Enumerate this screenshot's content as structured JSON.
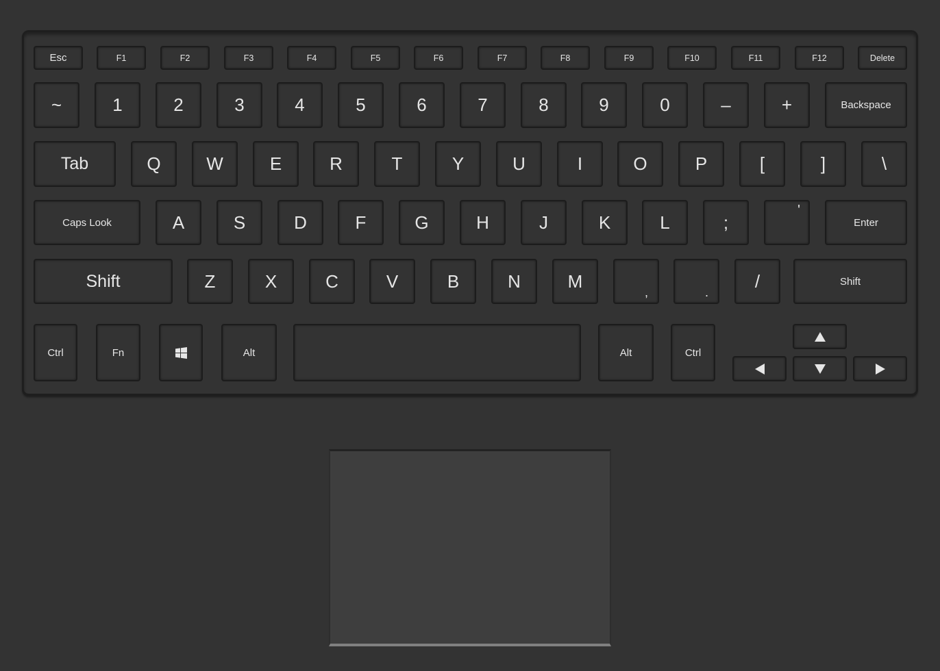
{
  "keyboard": {
    "function_row": [
      "Esc",
      "F1",
      "F2",
      "F3",
      "F4",
      "F5",
      "F6",
      "F7",
      "F8",
      "F9",
      "F10",
      "F11",
      "F12",
      "Delete"
    ],
    "number_row": [
      "~",
      "1",
      "2",
      "3",
      "4",
      "5",
      "6",
      "7",
      "8",
      "9",
      "0",
      "–",
      "+",
      "Backspace"
    ],
    "top_row": [
      "Tab",
      "Q",
      "W",
      "E",
      "R",
      "T",
      "Y",
      "U",
      "I",
      "O",
      "P",
      "[",
      "]",
      "\\"
    ],
    "home_row": [
      "Caps Look",
      "A",
      "S",
      "D",
      "F",
      "G",
      "H",
      "J",
      "K",
      "L",
      ";",
      "'",
      "Enter"
    ],
    "bottom_row": [
      "Shift",
      "Z",
      "X",
      "C",
      "V",
      "B",
      "N",
      "M",
      ",",
      ".",
      "/",
      "Shift"
    ],
    "modifier_row": {
      "left_ctrl": "Ctrl",
      "fn": "Fn",
      "windows_icon": "windows-logo",
      "left_alt": "Alt",
      "space": "",
      "right_alt": "Alt",
      "right_ctrl": "Ctrl"
    },
    "arrows": {
      "up": "arrow-up",
      "left": "arrow-left",
      "down": "arrow-down",
      "right": "arrow-right"
    }
  },
  "touchpad": {
    "label": "touchpad"
  },
  "colors": {
    "background": "#333333",
    "key_text": "#e6e6e6",
    "key_border": "#1c1c1c",
    "touchpad": "#3e3e3e"
  }
}
